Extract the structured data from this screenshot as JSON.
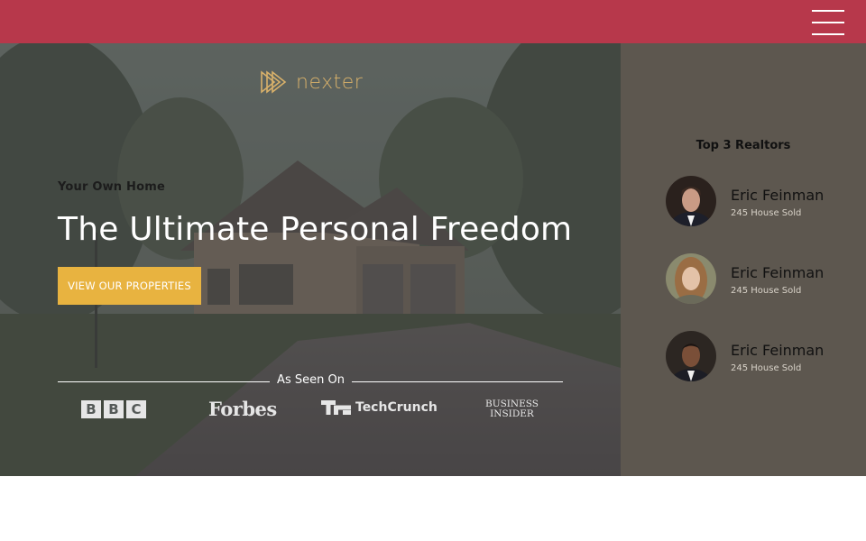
{
  "nav": {
    "menu_icon": "hamburger-menu-icon"
  },
  "hero": {
    "logo_text": "nexter",
    "eyebrow": "Your Own Home",
    "headline": "The Ultimate Personal Freedom",
    "cta_label": "VIEW OUR PROPERTIES",
    "seen_on_label": "As Seen On",
    "brands": {
      "bbc": [
        "B",
        "B",
        "C"
      ],
      "forbes": "Forbes",
      "techcrunch": "TechCrunch",
      "business_insider_line1": "BUSINESS",
      "business_insider_line2": "INSIDER"
    }
  },
  "sidebar": {
    "title": "Top 3 Realtors",
    "realtors": [
      {
        "name": "Eric Feinman",
        "sold": "245 House Sold"
      },
      {
        "name": "Eric Feinman",
        "sold": "245 House Sold"
      },
      {
        "name": "Eric Feinman",
        "sold": "245 House Sold"
      }
    ]
  },
  "colors": {
    "topbar": "#b7384b",
    "accent": "#e8b340",
    "sidebar": "#5d574f",
    "logo": "#d9b16a"
  }
}
